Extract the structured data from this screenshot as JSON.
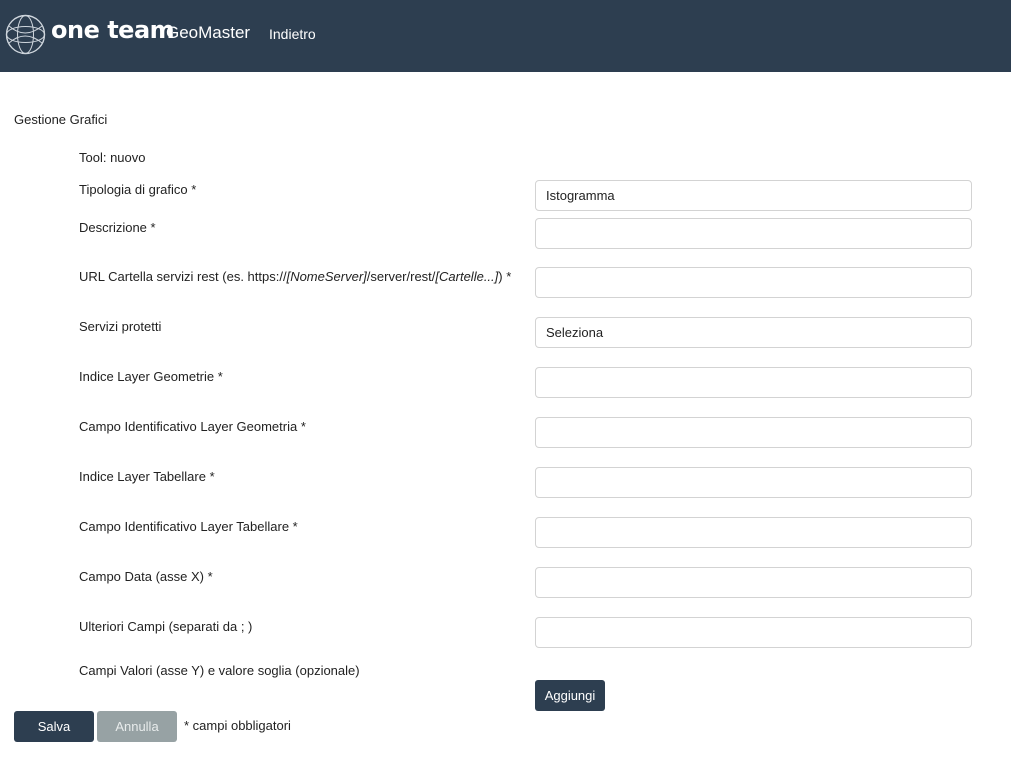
{
  "header": {
    "brand": "one team",
    "product": "GeoMaster",
    "back_link": "Indietro",
    "logo_icon": "globe-logo-icon",
    "background_color": "#2d3e50"
  },
  "page_title": "Gestione Grafici",
  "tool": "Tool: nuovo",
  "fields": {
    "tipologia": {
      "label": "Tipologia di grafico *",
      "value": "Istogramma"
    },
    "descrizione": {
      "label": "Descrizione *",
      "value": ""
    },
    "url": {
      "label_prefix": "URL Cartella servizi rest (es. https://",
      "label_server": "[NomeServer]",
      "label_middle": "/server/rest/",
      "label_folder": "[Cartelle...]",
      "label_suffix": ") *",
      "value": ""
    },
    "servizi_protetti": {
      "label": "Servizi protetti",
      "value": "Seleziona"
    },
    "indice_geometrie": {
      "label": "Indice Layer Geometrie *",
      "value": ""
    },
    "campo_id_geometria": {
      "label": "Campo Identificativo Layer Geometria *",
      "value": ""
    },
    "indice_tabellare": {
      "label": "Indice Layer Tabellare *",
      "value": ""
    },
    "campo_id_tabellare": {
      "label": "Campo Identificativo Layer Tabellare *",
      "value": ""
    },
    "campo_data": {
      "label": "Campo Data (asse X) *",
      "value": ""
    },
    "ulteriori_campi": {
      "label": "Ulteriori Campi (separati da ; )",
      "value": ""
    },
    "campi_valori": {
      "label": "Campi Valori (asse Y) e valore soglia (opzionale)"
    }
  },
  "buttons": {
    "add": "Aggiungi",
    "save": "Salva",
    "cancel": "Annulla"
  },
  "required_note": "* campi obbligatori"
}
